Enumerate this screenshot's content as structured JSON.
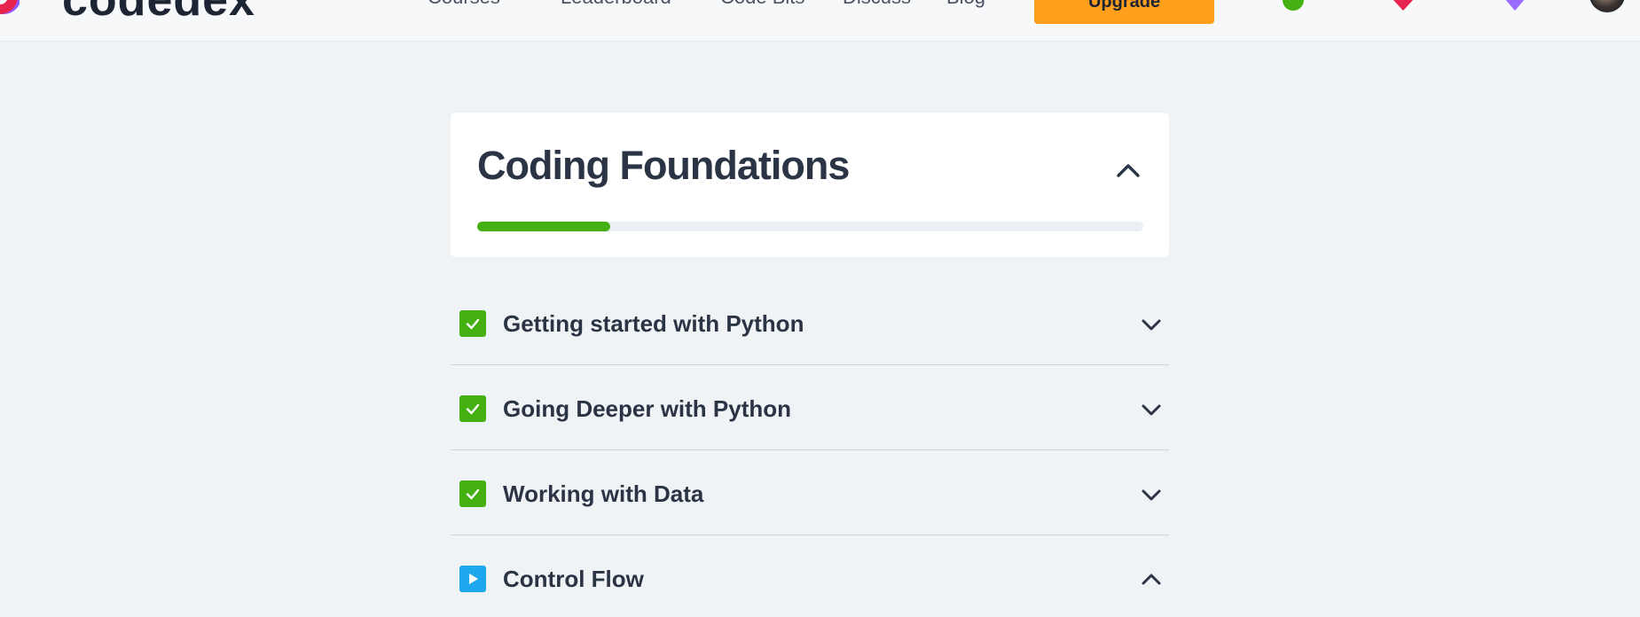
{
  "brand": {
    "name": "codedex"
  },
  "nav": {
    "links": [
      "Courses",
      "Leaderboard",
      "Code Bits",
      "Discuss",
      "Blog"
    ],
    "cta_label": "Upgrade",
    "stats": {
      "streak_icon": "green-badge-icon",
      "heart_icon": "heart-icon",
      "gem_icon": "gem-icon"
    }
  },
  "course": {
    "title": "Coding Foundations",
    "progress_percent": 20
  },
  "modules": [
    {
      "title": "Getting started with Python",
      "status": "completed",
      "expanded": false
    },
    {
      "title": "Going Deeper with Python",
      "status": "completed",
      "expanded": false
    },
    {
      "title": "Working with Data",
      "status": "completed",
      "expanded": false
    },
    {
      "title": "Control Flow",
      "status": "in-progress",
      "expanded": true
    }
  ],
  "colors": {
    "accent_green": "#45b012",
    "accent_blue": "#1ea7ed",
    "cta_orange": "#ff9f1c",
    "text_dark": "#2b3444",
    "page_bg": "#f0f3f6"
  }
}
